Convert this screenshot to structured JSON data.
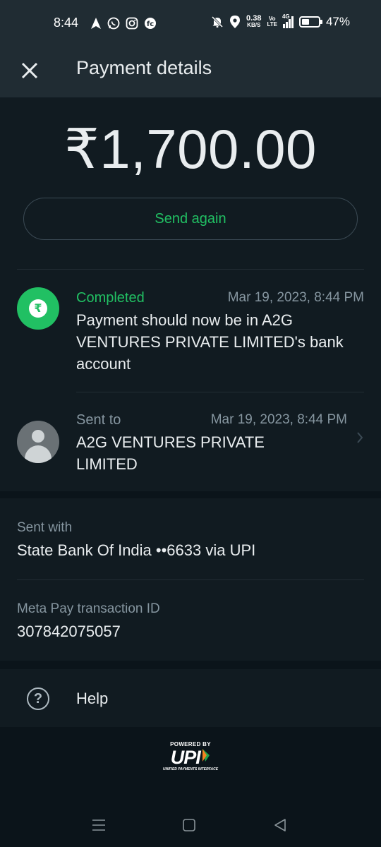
{
  "status_bar": {
    "time": "8:44",
    "net_speed": "0.38",
    "net_unit": "KB/S",
    "volte_top": "Vo",
    "volte_bottom": "LTE",
    "network": "4G",
    "battery_pct": "47%",
    "battery_level": 0.47
  },
  "header": {
    "title": "Payment details"
  },
  "payment": {
    "amount": "₹1,700.00",
    "send_again_label": "Send again",
    "status_label": "Completed",
    "status_time": "Mar 19, 2023, 8:44 PM",
    "status_desc": "Payment should now be in A2G VENTURES PRIVATE LIMITED's bank account",
    "sent_to_label": "Sent to",
    "sent_to_time": "Mar 19, 2023, 8:44 PM",
    "recipient": "A2G VENTURES PRIVATE LIMITED"
  },
  "details": {
    "sent_with_label": "Sent with",
    "sent_with_value": "State Bank Of India ••6633 via UPI",
    "txn_label": "Meta Pay transaction ID",
    "txn_value": "307842075057"
  },
  "help": {
    "label": "Help"
  },
  "footer": {
    "powered_by": "POWERED BY",
    "logo": "UPI",
    "tagline": "UNIFIED PAYMENTS INTERFACE"
  },
  "colors": {
    "accent": "#21c063",
    "bg": "#0b141a",
    "surface": "#111b21",
    "appbar": "#202c33"
  }
}
